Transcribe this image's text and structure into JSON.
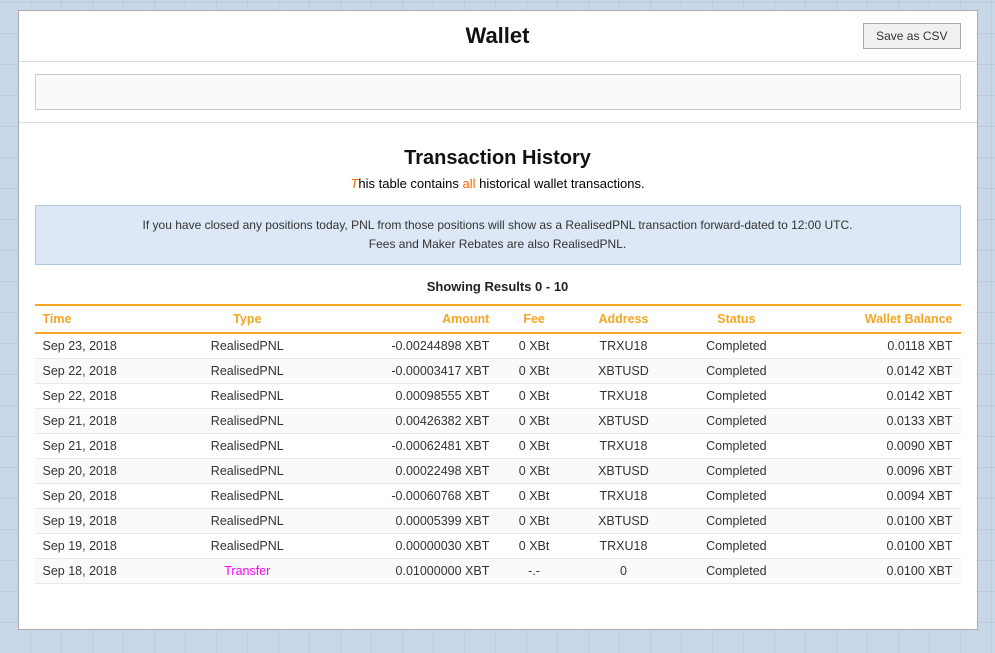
{
  "header": {
    "title": "Wallet",
    "save_csv_label": "Save as CSV"
  },
  "search": {
    "placeholder": ""
  },
  "transaction_history": {
    "title": "Transaction History",
    "subtitle_this": "T",
    "subtitle_his": "his",
    "subtitle_table": " table contains ",
    "subtitle_all": "all",
    "subtitle_rest": " historical wallet transactions.",
    "info_line1": "If you have closed any positions today, PNL from those positions will show as a RealisedPNL transaction forward-dated to 12:00 UTC.",
    "info_line2": "Fees and Maker Rebates are also RealisedPNL.",
    "showing_results": "Showing Results 0 - 10"
  },
  "table": {
    "headers": [
      "Time",
      "Type",
      "Amount",
      "Fee",
      "Address",
      "Status",
      "Wallet Balance"
    ],
    "rows": [
      {
        "time": "Sep 23, 2018",
        "type": "RealisedPNL",
        "type_class": "realised",
        "amount": "-0.00244898 XBT",
        "fee": "0 XBt",
        "address": "TRXU18",
        "status": "Completed",
        "balance": "0.0118 XBT"
      },
      {
        "time": "Sep 22, 2018",
        "type": "RealisedPNL",
        "type_class": "realised",
        "amount": "-0.00003417 XBT",
        "fee": "0 XBt",
        "address": "XBTUSD",
        "status": "Completed",
        "balance": "0.0142 XBT"
      },
      {
        "time": "Sep 22, 2018",
        "type": "RealisedPNL",
        "type_class": "realised",
        "amount": "0.00098555 XBT",
        "fee": "0 XBt",
        "address": "TRXU18",
        "status": "Completed",
        "balance": "0.0142 XBT"
      },
      {
        "time": "Sep 21, 2018",
        "type": "RealisedPNL",
        "type_class": "realised",
        "amount": "0.00426382 XBT",
        "fee": "0 XBt",
        "address": "XBTUSD",
        "status": "Completed",
        "balance": "0.0133 XBT"
      },
      {
        "time": "Sep 21, 2018",
        "type": "RealisedPNL",
        "type_class": "realised",
        "amount": "-0.00062481 XBT",
        "fee": "0 XBt",
        "address": "TRXU18",
        "status": "Completed",
        "balance": "0.0090 XBT"
      },
      {
        "time": "Sep 20, 2018",
        "type": "RealisedPNL",
        "type_class": "realised",
        "amount": "0.00022498 XBT",
        "fee": "0 XBt",
        "address": "XBTUSD",
        "status": "Completed",
        "balance": "0.0096 XBT"
      },
      {
        "time": "Sep 20, 2018",
        "type": "RealisedPNL",
        "type_class": "realised",
        "amount": "-0.00060768 XBT",
        "fee": "0 XBt",
        "address": "TRXU18",
        "status": "Completed",
        "balance": "0.0094 XBT"
      },
      {
        "time": "Sep 19, 2018",
        "type": "RealisedPNL",
        "type_class": "realised",
        "amount": "0.00005399 XBT",
        "fee": "0 XBt",
        "address": "XBTUSD",
        "status": "Completed",
        "balance": "0.0100 XBT"
      },
      {
        "time": "Sep 19, 2018",
        "type": "RealisedPNL",
        "type_class": "realised",
        "amount": "0.00000030 XBT",
        "fee": "0 XBt",
        "address": "TRXU18",
        "status": "Completed",
        "balance": "0.0100 XBT"
      },
      {
        "time": "Sep 18, 2018",
        "type": "Transfer",
        "type_class": "transfer",
        "amount": "0.01000000 XBT",
        "fee": "-.-",
        "address": "0",
        "status": "Completed",
        "balance": "0.0100 XBT"
      }
    ]
  }
}
